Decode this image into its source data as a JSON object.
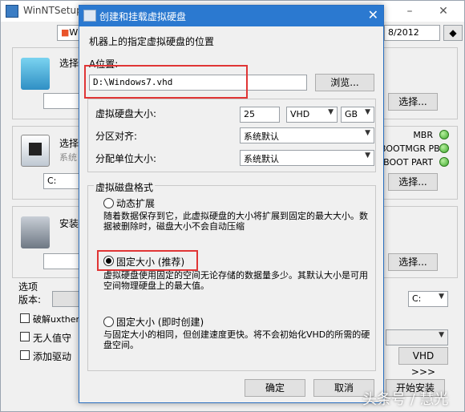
{
  "bg": {
    "title": "WinNTSetup",
    "date_fragment": "8/2012",
    "combo_w": "W",
    "group1": {
      "label": "选择",
      "button": "选择..."
    },
    "group2": {
      "label": "选择",
      "sub": "系统",
      "drive": "C:",
      "button": "选择...",
      "status": [
        {
          "label": "MBR"
        },
        {
          "label": "BOOTMGR PBR"
        },
        {
          "label": "BOOT PART"
        }
      ]
    },
    "group3": {
      "label": "安装",
      "button": "选择..."
    },
    "options": {
      "label": "选项",
      "version_label": "版本:",
      "drive": "C:",
      "checks": [
        "破解uxtheme",
        "无人值守",
        "添加驱动"
      ],
      "vhd_button": "VHD >>>",
      "start_button": "开始安装"
    }
  },
  "dialog": {
    "title": "创建和挂载虚拟硬盘",
    "header": "机器上的指定虚拟硬盘的位置",
    "location_label": "A位置:",
    "location_value": "D:\\Windows7.vhd",
    "browse_button": "浏览...",
    "size_label": "虚拟硬盘大小:",
    "size_value": "25",
    "type_value": "VHD",
    "unit_value": "GB",
    "align_label": "分区对齐:",
    "align_value": "系统默认",
    "alloc_label": "分配单位大小:",
    "alloc_value": "系统默认",
    "format_group": "虚拟磁盘格式",
    "options": [
      {
        "label": "动态扩展",
        "desc": "随着数据保存到它，此虚拟硬盘的大小将扩展到固定的最大大小。数据被删除时，磁盘大小不会自动压缩",
        "selected": false
      },
      {
        "label": "固定大小 (推荐)",
        "desc": "虚拟硬盘使用固定的空间无论存储的数据量多少。其默认大小是可用空间物理硬盘上的最大值。",
        "selected": true
      },
      {
        "label": "固定大小 (即时创建)",
        "desc": "与固定大小的相同，但创建速度更快。将不会初始化VHD的所需的硬盘空间。",
        "selected": false
      }
    ],
    "ok_button": "确定",
    "cancel_button": "取消"
  },
  "watermark": "头条号 / 慧光",
  "colors": {
    "title_blue": "#2b79d0",
    "highlight_red": "#e03535",
    "status_green": "#3fa92c"
  }
}
